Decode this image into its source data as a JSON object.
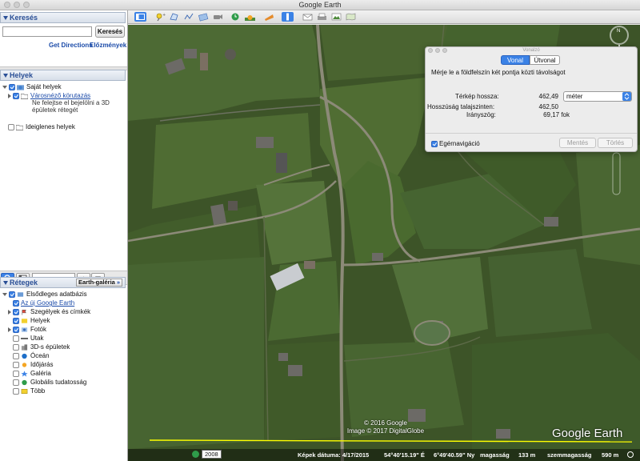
{
  "window": {
    "title": "Google Earth"
  },
  "search": {
    "header": "Keresés",
    "input_value": "",
    "button": "Keresés",
    "get_directions": "Get Directions",
    "history": "Előzmények"
  },
  "places": {
    "header": "Helyek",
    "items": [
      {
        "label": "Saját helyek"
      },
      {
        "label": "Városnéző körutazás",
        "subtext_1": "Ne felejtse el bejelölni a 3D",
        "subtext_2": "épületek rétegét"
      },
      {
        "label": "Ideiglenes helyek"
      }
    ]
  },
  "layers": {
    "header": "Rétegek",
    "gallery_button": "Earth-galéria",
    "items": [
      {
        "label": "Elsődleges adatbázis",
        "checked": true
      },
      {
        "label": "Az új Google Earth",
        "checked": true,
        "link": true
      },
      {
        "label": "Szegélyek és címkék",
        "checked": true
      },
      {
        "label": "Helyek",
        "checked": true
      },
      {
        "label": "Fotók",
        "checked": true
      },
      {
        "label": "Utak",
        "checked": false
      },
      {
        "label": "3D-s épületek",
        "checked": false
      },
      {
        "label": "Óceán",
        "checked": false
      },
      {
        "label": "Időjárás",
        "checked": false
      },
      {
        "label": "Galéria",
        "checked": false
      },
      {
        "label": "Globális tudatosság",
        "checked": false
      },
      {
        "label": "Több",
        "checked": false
      }
    ]
  },
  "ruler": {
    "title": "Vonalzó",
    "tab_line": "Vonal",
    "tab_path": "Útvonal",
    "instruction": "Mérje le a földfelszín két pontja közti távolságot",
    "map_length_label": "Térkép hossza:",
    "map_length_value": "462,49",
    "unit": "méter",
    "ground_length_label": "Hosszúság talajszinten:",
    "ground_length_value": "462,50",
    "heading_label": "Irányszög:",
    "heading_value": "69,17 fok",
    "mouse_nav_label": "Egérnavigáció",
    "mouse_nav_checked": true,
    "save_button": "Mentés",
    "clear_button": "Törlés"
  },
  "map": {
    "copyright_1": "© 2016 Google",
    "copyright_2": "Image © 2017 DigitalGlobe",
    "logo": "Google Earth"
  },
  "status": {
    "year": "2008",
    "image_date": "Képek dátuma: 4/17/2015",
    "lat": "54°40'15.19\" É",
    "lon": "6°49'40.59\" Ny",
    "elevation_label": "magasság",
    "elevation": "133 m",
    "eye_alt_label": "szemmagasság",
    "eye_alt": "590 m"
  },
  "colors": {
    "accent": "#3b82e6",
    "link": "#1a4aa8",
    "panel_header": "#2a4f96",
    "measure_line": "#ffff00"
  }
}
